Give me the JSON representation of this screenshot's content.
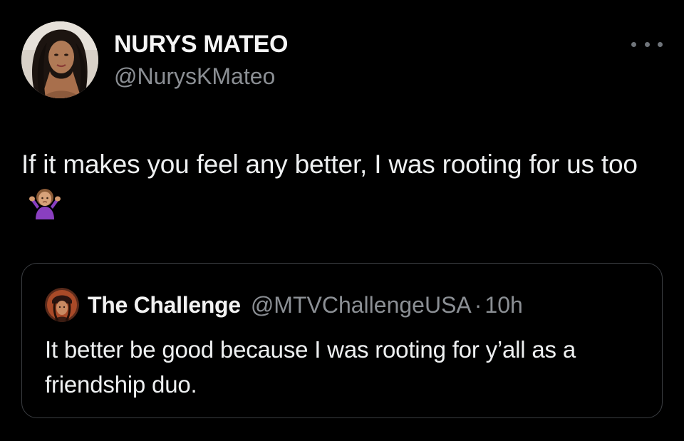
{
  "tweet": {
    "author": {
      "display_name": "NURYS MATEO",
      "handle": "@NurysKMateo",
      "avatar_icon": "profile-photo"
    },
    "more_icon": "more-options-icon",
    "text": "If it makes you feel any better, I was rooting for us too",
    "emoji_icon": "person-shrugging-emoji"
  },
  "quote": {
    "author": {
      "display_name": "The Challenge",
      "handle": "@MTVChallengeUSA",
      "avatar_icon": "show-logo"
    },
    "separator": "·",
    "time": "10h",
    "text": "It better be good because I was rooting for y’all as a friendship duo."
  },
  "colors": {
    "background": "#000000",
    "primary_text": "#e7e9ea",
    "secondary_text": "#8b8f94",
    "border": "#3a3d41",
    "emoji_purple": "#8a3fc0"
  }
}
